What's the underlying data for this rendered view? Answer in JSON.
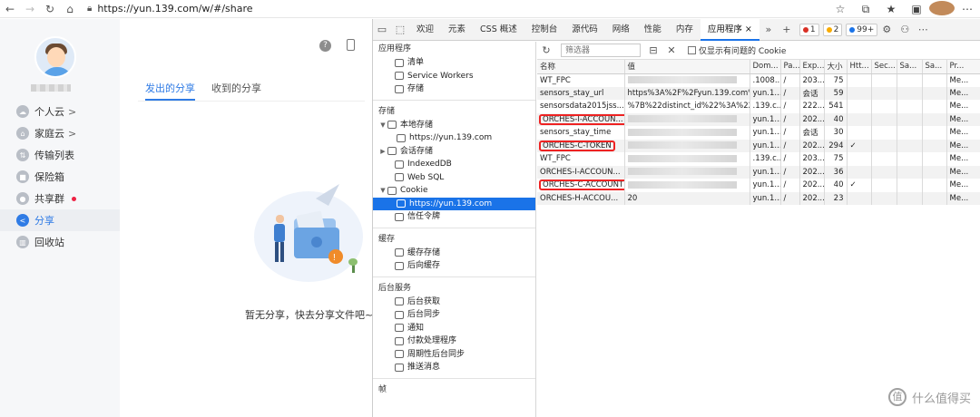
{
  "browser": {
    "url": "https://yun.139.com/w/#/share"
  },
  "app": {
    "menu": [
      {
        "label": "个人云",
        "arrow": ">",
        "icon": "cloud-icon"
      },
      {
        "label": "家庭云",
        "arrow": ">",
        "icon": "home-icon"
      },
      {
        "label": "传输列表",
        "icon": "transfer-icon"
      },
      {
        "label": "保险箱",
        "icon": "safe-icon"
      },
      {
        "label": "共享群",
        "icon": "group-icon"
      },
      {
        "label": "分享",
        "icon": "share-icon"
      },
      {
        "label": "回收站",
        "icon": "trash-icon"
      }
    ],
    "tabs": [
      "发出的分享",
      "收到的分享"
    ],
    "empty_text": "暂无分享，快去分享文件吧~"
  },
  "devtools": {
    "tabs": [
      "欢迎",
      "元素",
      "CSS 概述",
      "控制台",
      "源代码",
      "网络",
      "性能",
      "内存",
      "应用程序"
    ],
    "badges": {
      "errors": "1",
      "warnings": "2",
      "info": "99+"
    },
    "sections": {
      "app": "应用程序",
      "app_items": [
        "清单",
        "Service Workers",
        "存储"
      ],
      "storage": "存储",
      "storage_items": [
        "本地存储",
        "https://yun.139.com",
        "会话存储",
        "IndexedDB",
        "Web SQL",
        "Cookie",
        "https://yun.139.com",
        "信任令牌"
      ],
      "cache": "缓存",
      "cache_items": [
        "缓存存储",
        "后向缓存"
      ],
      "bg": "后台服务",
      "bg_items": [
        "后台获取",
        "后台同步",
        "通知",
        "付款处理程序",
        "周期性后台同步",
        "推送消息"
      ],
      "frames": "帧"
    },
    "toolbar": {
      "filter_placeholder": "筛选器",
      "only_issues": "仅显示有问题的 Cookie"
    },
    "columns": [
      "名称",
      "值",
      "Dom...",
      "Pa...",
      "Exp...",
      "大小",
      "Htt...",
      "Sec...",
      "Sa...",
      "Sa...",
      "Pr..."
    ],
    "rows": [
      {
        "name": "WT_FPC",
        "value": "",
        "domain": ".1008...",
        "path": "/",
        "exp": "203...",
        "size": "75",
        "http": "",
        "pr": "Me..."
      },
      {
        "name": "sensors_stay_url",
        "value": "https%3A%2F%2Fyun.139.com%...",
        "domain": "yun.1...",
        "path": "/",
        "exp": "会话",
        "size": "59",
        "http": "",
        "pr": "Me..."
      },
      {
        "name": "sensorsdata2015jss...",
        "value": "%7B%22distinct_id%22%3A%22...",
        "domain": ".139.c...",
        "path": "/",
        "exp": "222...",
        "size": "541",
        "http": "",
        "pr": "Me..."
      },
      {
        "name": "ORCHES-I-ACCOUN...",
        "value": "",
        "domain": "yun.1...",
        "path": "/",
        "exp": "202...",
        "size": "40",
        "http": "",
        "pr": "Me..."
      },
      {
        "name": "sensors_stay_time",
        "value": "",
        "domain": "yun.1...",
        "path": "/",
        "exp": "会话",
        "size": "30",
        "http": "",
        "pr": "Me..."
      },
      {
        "name": "ORCHES-C-TOKEN",
        "value": "",
        "domain": "yun.1...",
        "path": "/",
        "exp": "202...",
        "size": "294",
        "http": "✓",
        "pr": "Me..."
      },
      {
        "name": "WT_FPC",
        "value": "",
        "domain": ".139.c...",
        "path": "/",
        "exp": "203...",
        "size": "75",
        "http": "",
        "pr": "Me..."
      },
      {
        "name": "ORCHES-I-ACCOUN...",
        "value": "",
        "domain": "yun.1...",
        "path": "/",
        "exp": "202...",
        "size": "36",
        "http": "",
        "pr": "Me..."
      },
      {
        "name": "ORCHES-C-ACCOUNT",
        "value": "",
        "domain": "yun.1...",
        "path": "/",
        "exp": "202...",
        "size": "40",
        "http": "✓",
        "pr": "Me..."
      },
      {
        "name": "ORCHES-H-ACCOU...",
        "value": "20",
        "domain": "yun.1...",
        "path": "/",
        "exp": "202...",
        "size": "23",
        "http": "",
        "pr": "Me..."
      }
    ],
    "highlight_color": "#e22222"
  },
  "watermark": {
    "text": "什么值得买",
    "icon": "值"
  }
}
